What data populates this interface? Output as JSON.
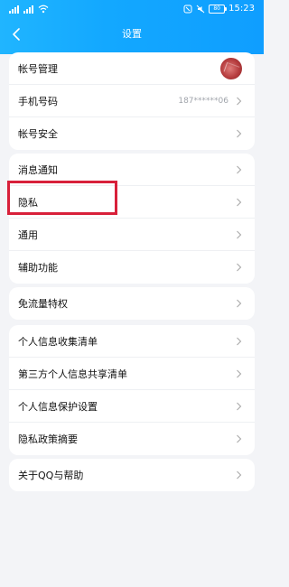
{
  "status_bar": {
    "time": "15:23",
    "battery": "80"
  },
  "navbar": {
    "title": "设置"
  },
  "sections": [
    {
      "rows": [
        {
          "label": "帐号管理",
          "value": "",
          "trailing": "avatar"
        },
        {
          "label": "手机号码",
          "value": "187******06"
        },
        {
          "label": "帐号安全",
          "value": ""
        }
      ]
    },
    {
      "rows": [
        {
          "label": "消息通知"
        },
        {
          "label": "隐私"
        },
        {
          "label": "通用"
        },
        {
          "label": "辅助功能"
        }
      ]
    },
    {
      "rows": [
        {
          "label": "免流量特权"
        }
      ]
    },
    {
      "rows": [
        {
          "label": "个人信息收集清单"
        },
        {
          "label": "第三方个人信息共享清单"
        },
        {
          "label": "个人信息保护设置"
        },
        {
          "label": "隐私政策摘要"
        }
      ]
    },
    {
      "rows": [
        {
          "label": "关于QQ与帮助"
        }
      ]
    }
  ],
  "colors": {
    "header": "#13a8ff",
    "background": "#f3f4f7",
    "highlight": "#d8203a"
  }
}
